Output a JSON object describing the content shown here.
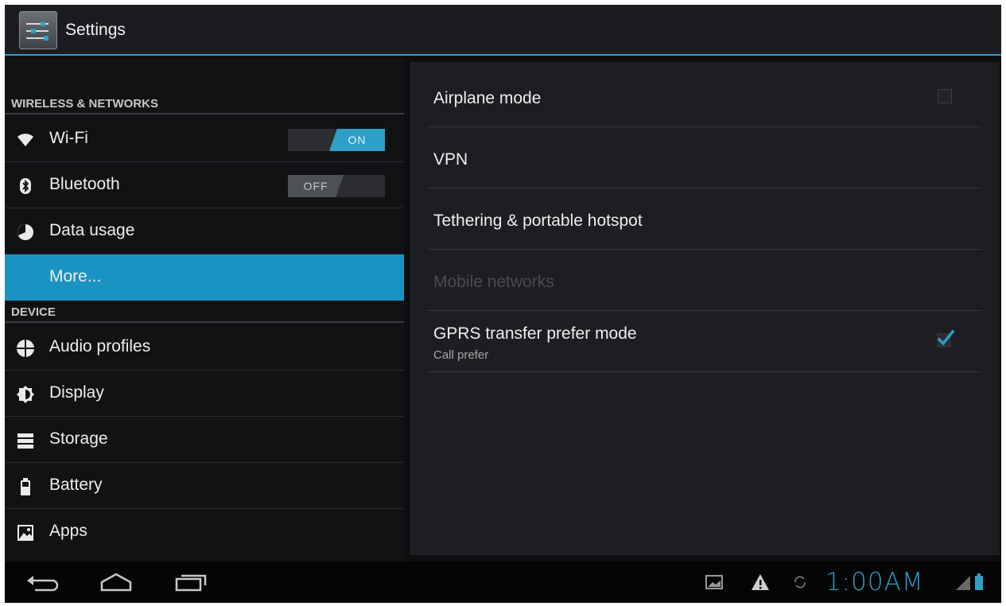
{
  "app": {
    "title": "Settings",
    "icon": "settings-sliders-icon"
  },
  "sidebar": {
    "sections": [
      {
        "header": "WIRELESS & NETWORKS",
        "items": [
          {
            "label": "Wi-Fi",
            "icon": "wifi-icon",
            "toggle": "ON"
          },
          {
            "label": "Bluetooth",
            "icon": "bluetooth-icon",
            "toggle": "OFF"
          },
          {
            "label": "Data usage",
            "icon": "data-usage-icon"
          },
          {
            "label": "More...",
            "icon": "",
            "selected": true
          }
        ]
      },
      {
        "header": "DEVICE",
        "items": [
          {
            "label": "Audio profiles",
            "icon": "audio-profiles-icon"
          },
          {
            "label": "Display",
            "icon": "display-icon"
          },
          {
            "label": "Storage",
            "icon": "storage-icon"
          },
          {
            "label": "Battery",
            "icon": "battery-icon"
          },
          {
            "label": "Apps",
            "icon": "apps-icon"
          }
        ]
      }
    ]
  },
  "main": {
    "prefs": [
      {
        "title": "Airplane mode",
        "checkbox": false
      },
      {
        "title": "VPN"
      },
      {
        "title": "Tethering & portable hotspot"
      },
      {
        "title": "Mobile networks",
        "disabled": true
      },
      {
        "title": "GPRS transfer prefer mode",
        "summary": "Call prefer",
        "checkbox": true
      }
    ]
  },
  "statusbar": {
    "time": "1:00AM"
  },
  "colors": {
    "accent": "#2e9fc7",
    "background": "#0d0e10"
  }
}
